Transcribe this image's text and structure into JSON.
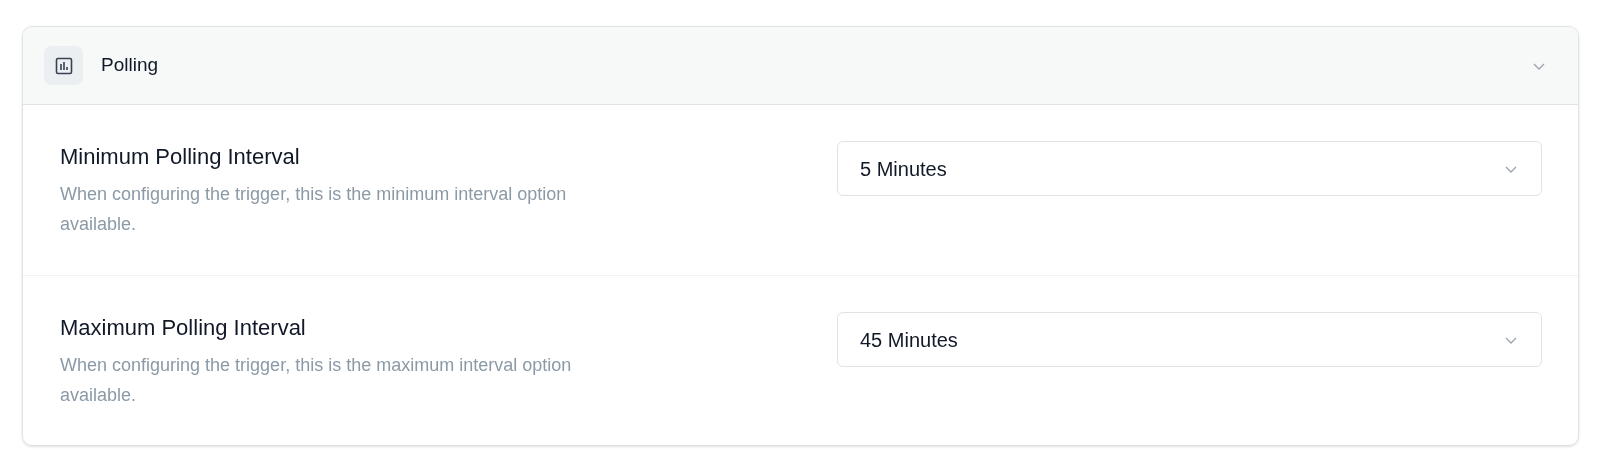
{
  "section": {
    "title": "Polling",
    "expanded": true
  },
  "settings": [
    {
      "label": "Minimum Polling Interval",
      "description": "When configuring the trigger, this is the minimum interval option available.",
      "value": "5 Minutes"
    },
    {
      "label": "Maximum Polling Interval",
      "description": "When configuring the trigger, this is the maximum interval option available.",
      "value": "45 Minutes"
    }
  ]
}
